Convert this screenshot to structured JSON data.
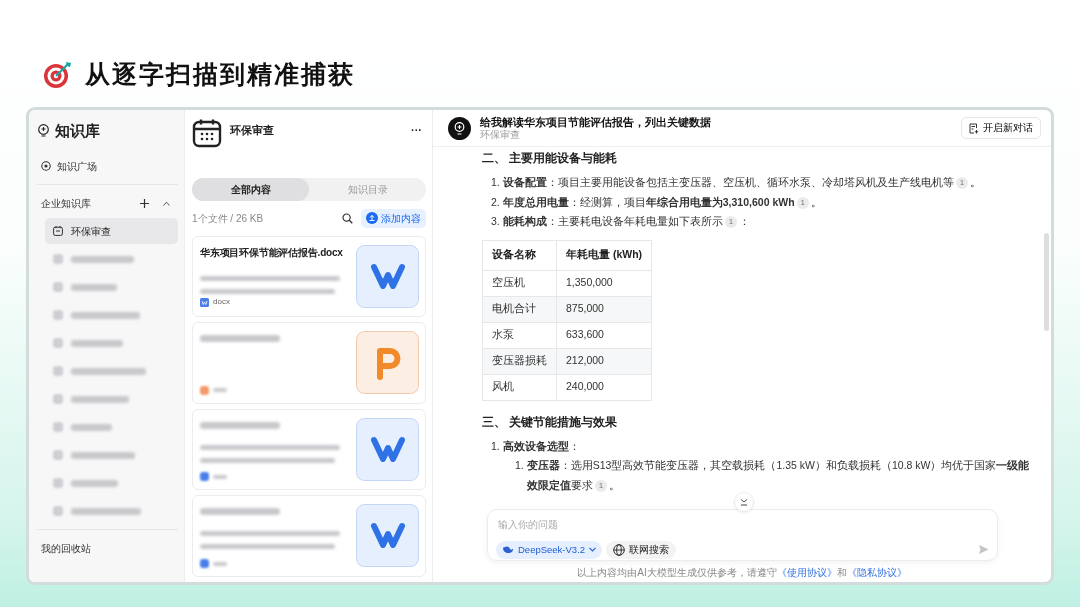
{
  "slide_title": "从逐字扫描到精准捕获",
  "sidebar": {
    "title": "知识库",
    "plaza": "知识广场",
    "section": "企业知识库",
    "items": [
      {
        "kind": "named",
        "label": "环保审查",
        "selected": true
      },
      {
        "kind": "blurred",
        "selected": false
      },
      {
        "kind": "blurred",
        "selected": false
      },
      {
        "kind": "blurred",
        "selected": false
      },
      {
        "kind": "blurred",
        "selected": false
      },
      {
        "kind": "blurred",
        "selected": false
      },
      {
        "kind": "blurred",
        "selected": false
      },
      {
        "kind": "blurred",
        "selected": false
      },
      {
        "kind": "blurred",
        "selected": false
      },
      {
        "kind": "blurred",
        "selected": false
      },
      {
        "kind": "blurred",
        "selected": false
      }
    ],
    "recycle": "我的回收站"
  },
  "library": {
    "title": "环保审查",
    "more": "···",
    "tabs": [
      {
        "label": "全部内容",
        "selected": true
      },
      {
        "label": "知识目录",
        "selected": false
      }
    ],
    "file_info": "1个文件 / 26 KB",
    "add_button": "添加内容",
    "files": [
      {
        "kind": "docx",
        "name": "华东项目环保节能评估报告.docx",
        "type_label": "docx"
      },
      {
        "kind": "pptx"
      },
      {
        "kind": "docx"
      },
      {
        "kind": "docx"
      }
    ]
  },
  "chat": {
    "title": "给我解读华东项目节能评估报告，列出关键数据",
    "subtitle": "环保审查",
    "new_chat": "开启新对话",
    "content": [
      {
        "kind": "heading",
        "text": "二、 主要用能设备与能耗"
      },
      {
        "kind": "list",
        "items": [
          {
            "number": "1.",
            "text": "**设备配置**：项目主要用能设备包括主变压器、空压机、循环水泵、冷却塔风机及生产线电机等",
            "cite": "1",
            "end": "。"
          },
          {
            "number": "2.",
            "text": "**年度总用电量**：经测算，项目**年综合用电量为3,310,600 kWh**",
            "cite": "1",
            "end": "。"
          },
          {
            "number": "3.",
            "text": "**能耗构成**：主要耗电设备年耗电量如下表所示",
            "cite": "1",
            "end": "："
          }
        ]
      },
      {
        "kind": "table",
        "columns": [
          "设备名称",
          "年耗电量 (kWh)"
        ],
        "rows": [
          [
            "空压机",
            "1,350,000"
          ],
          [
            "电机合计",
            "875,000"
          ],
          [
            "水泵",
            "633,600"
          ],
          [
            "变压器损耗",
            "212,000"
          ],
          [
            "风机",
            "240,000"
          ]
        ]
      },
      {
        "kind": "heading",
        "text": "三、 关键节能措施与效果"
      },
      {
        "kind": "list",
        "items": [
          {
            "number": "1.",
            "text": "**高效设备选型**：",
            "children": [
              {
                "number": "1.",
                "text": "**变压器**：选用S13型高效节能变压器，其空载损耗（1.35 kW）和负载损耗（10.8 kW）均优于国家**一级能效限定值**要求",
                "cite": "1",
                "end": "。"
              }
            ]
          }
        ]
      }
    ],
    "input": {
      "placeholder": "输入你的问题",
      "model": "DeepSeek-V3.2",
      "web_search": "联网搜索"
    },
    "disclaimer": {
      "text": "以上内容均由AI大模型生成仅供参考，请遵守",
      "link1": "《使用协议》",
      "joiner": "和",
      "link2": "《隐私协议》"
    }
  }
}
